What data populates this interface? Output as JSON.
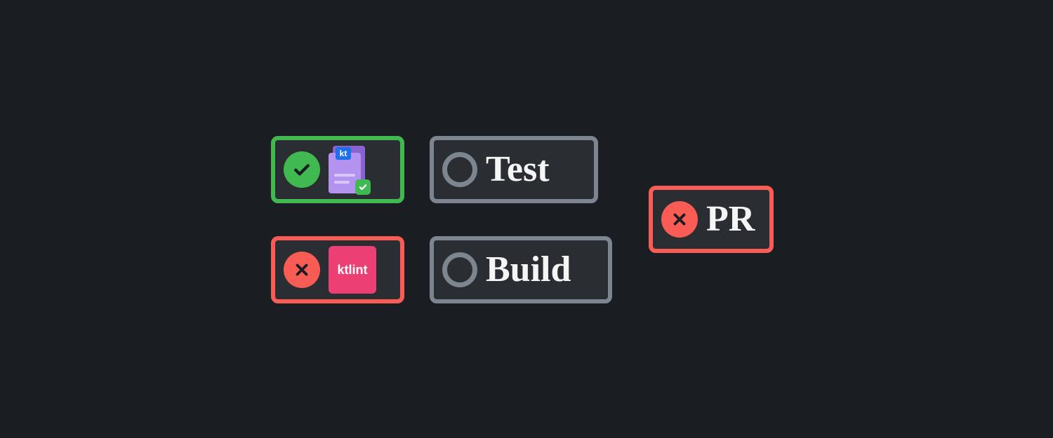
{
  "pipeline": {
    "jobs": [
      {
        "id": "kt",
        "status": "success",
        "icon": "kotlin-file",
        "kt_tag": "kt"
      },
      {
        "id": "ktlint",
        "status": "fail",
        "icon": "ktlint-box",
        "ktlint_label": "ktlint"
      },
      {
        "id": "test",
        "status": "pending",
        "label": "Test"
      },
      {
        "id": "build",
        "status": "pending",
        "label": "Build"
      },
      {
        "id": "pr",
        "status": "fail",
        "label": "PR"
      }
    ]
  },
  "colors": {
    "success": "#3fb950",
    "fail": "#f85c54",
    "neutral": "#7d8590",
    "bg": "#1a1d21",
    "card_bg": "#2a2e33",
    "ktlint_pink": "#ec4074",
    "kotlin_purple_dark": "#8a63d2",
    "kotlin_purple_light": "#b392f0",
    "kt_tag_blue": "#1f6feb"
  }
}
